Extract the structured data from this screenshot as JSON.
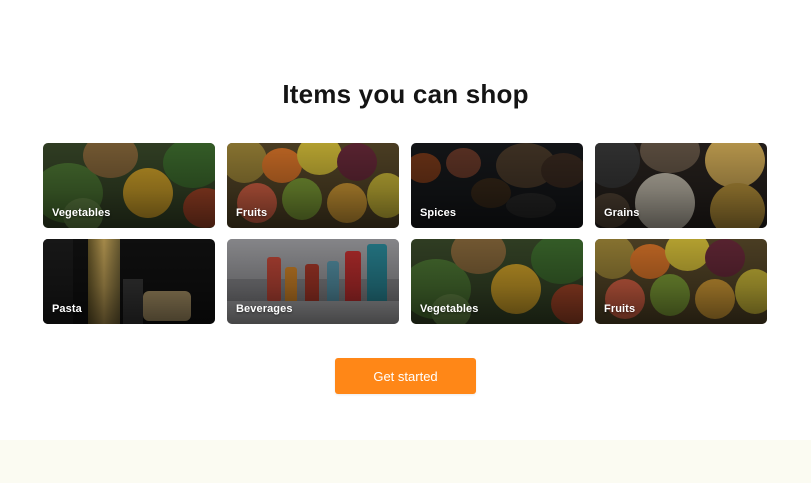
{
  "section": {
    "heading": "Items you can shop"
  },
  "categories": [
    {
      "label": "Vegetables"
    },
    {
      "label": "Fruits"
    },
    {
      "label": "Spices"
    },
    {
      "label": "Grains"
    },
    {
      "label": "Pasta"
    },
    {
      "label": "Beverages"
    },
    {
      "label": "Vegetables"
    },
    {
      "label": "Fruits"
    }
  ],
  "cta": {
    "label": "Get started"
  },
  "colors": {
    "accent": "#ff8717",
    "heading": "#141414",
    "footer_band": "#fbfbf2"
  }
}
